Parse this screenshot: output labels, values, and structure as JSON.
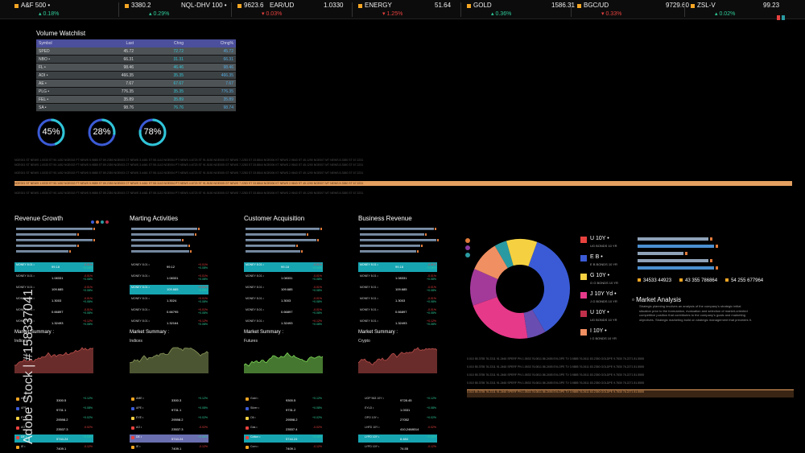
{
  "ticker": [
    {
      "name": "A&F 500 •",
      "value": "",
      "change": "0.18% ",
      "dir": "up"
    },
    {
      "name": "3380.2",
      "value": "NQL-DHV 100 •",
      "change": "0.29% ",
      "dir": "up"
    },
    {
      "name": "9623.6",
      "value": "EAR/UD",
      "change": "0.03% ",
      "dir": "dn"
    },
    {
      "name": "",
      "value": "1.0330",
      "change": "",
      "dir": "dn"
    },
    {
      "name": "ENERGY",
      "value": "51.64",
      "change": "1.25% ",
      "dir": "dn"
    },
    {
      "name": "GOLD",
      "value": "1586.31",
      "change": "0.36% ",
      "dir": "up"
    },
    {
      "name": "BGC/UD",
      "value": "9729.60",
      "change": "0.33% ",
      "dir": "dn"
    },
    {
      "name": "ZSL-V",
      "value": "99.23",
      "change": "0.02% ",
      "dir": "up"
    }
  ],
  "watchlist": {
    "title": "Volume Watchlist",
    "columns": [
      "Symbol",
      "Last",
      "Chng",
      "Chng%"
    ],
    "rows": [
      [
        "SPED",
        "45.72",
        "72.72",
        "45.72"
      ],
      [
        "NBO •",
        "66.31",
        "31.31",
        "66.31"
      ],
      [
        "FL •",
        "98.46",
        "46.46",
        "98.46"
      ],
      [
        "ADI •",
        "466.35",
        "35.35",
        "466.35"
      ],
      [
        "AE •",
        "7.67",
        "67.67",
        "7.67"
      ],
      [
        "PLG •",
        "776.35",
        "35.35",
        "776.35"
      ],
      [
        "FEL •",
        "35.89",
        "35.89",
        "35.89"
      ],
      [
        "SA •",
        "98.76",
        "76.76",
        "98.74"
      ]
    ]
  },
  "gauges": [
    {
      "label": "45%",
      "value": 0.45
    },
    {
      "label": "28%",
      "value": 0.28
    },
    {
      "label": "78%",
      "value": 0.78
    }
  ],
  "colors": {
    "teal": "#17a5b2",
    "orange": "#e5a060",
    "blue": "#3b5bd6",
    "ticker_accent": "#f5a623"
  },
  "panels": [
    {
      "title": "Revenue Growth",
      "summary": "Market Summary :",
      "sub": "Indices",
      "chart_color": "#c0504d",
      "rows": [
        {
          "a": "MONEY 8.01 •",
          "b": "99.18",
          "c1": "-0.01%",
          "c2": "+0.08%",
          "hl": true
        },
        {
          "a": "MONEY 8.01 •",
          "b": "1.08331",
          "c1": "-0.01%",
          "c2": "+0.08%",
          "hl": false
        },
        {
          "a": "MONEY 8.01 •",
          "b": "109.685",
          "c1": "-0.01%",
          "c2": "+0.08%",
          "hl": false
        },
        {
          "a": "MONEY 8.01 •",
          "b": "1.3003",
          "c1": "-0.01%",
          "c2": "+0.08%",
          "hl": false
        },
        {
          "a": "MONEY 8.01 •",
          "b": "0.66897",
          "c1": "-0.01%",
          "c2": "+0.08%",
          "hl": false
        },
        {
          "a": "MONEY 8.01 •",
          "b": "1.32493",
          "c1": "+0.12%",
          "c2": "+0.08%",
          "hl": false
        }
      ],
      "details": [
        {
          "a": "AME •",
          "b": "3300.5",
          "c": "+0.12%",
          "hl": "",
          "dot": "#f5a623"
        },
        {
          "a": "APE •",
          "b": "9731.1",
          "c": "+0.08%",
          "hl": "",
          "dot": "#3b5bd6"
        },
        {
          "a": "EYE •",
          "b": "29598.2",
          "c": "+0.02%",
          "hl": "",
          "dot": "#f5d142"
        },
        {
          "a": "AO •",
          "b": "23537.3",
          "c": "-0.02%",
          "hl": "",
          "dot": "#e8423f"
        },
        {
          "a": "DE •",
          "b": "5744.24",
          "c": "+0.08%",
          "hl": "hl",
          "dot": "#e8423f"
        },
        {
          "a": "IE •",
          "b": "7409.1",
          "c": "-0.12%",
          "hl": "",
          "dot": "#f5a623"
        }
      ]
    },
    {
      "title": "Marting Activities",
      "summary": "Market Summary :",
      "sub": "Indices",
      "chart_color": "#8a9a5b",
      "rows": [
        {
          "a": "MONEY 8.01 •",
          "b": "99.12",
          "c1": "+0.01%",
          "c2": "+0.08%",
          "hl": false
        },
        {
          "a": "MONEY 8.01 •",
          "b": "1.08331",
          "c1": "+0.01%",
          "c2": "+0.08%",
          "hl": false
        },
        {
          "a": "MONEY 8.01 •",
          "b": "109.685",
          "c1": "+0.01%",
          "c2": "+0.08%",
          "hl": true
        },
        {
          "a": "MONEY 8.01 •",
          "b": "1.3024",
          "c1": "+0.01%",
          "c2": "+0.08%",
          "hl": false
        },
        {
          "a": "MONEY 8.01 •",
          "b": "0.66795",
          "c1": "+0.01%",
          "c2": "+0.08%",
          "hl": false
        },
        {
          "a": "MONEY 8.01 •",
          "b": "1.32164",
          "c1": "+0.12%",
          "c2": "+0.08%",
          "hl": false
        }
      ],
      "details": [
        {
          "a": "AME •",
          "b": "3300.3",
          "c": "+0.12%",
          "hl": "",
          "dot": "#f5a623"
        },
        {
          "a": "APE •",
          "b": "9731.1",
          "c": "+0.08%",
          "hl": "",
          "dot": "#3b5bd6"
        },
        {
          "a": "EYE •",
          "b": "29598.2",
          "c": "+0.02%",
          "hl": "",
          "dot": "#f5d142"
        },
        {
          "a": "AO •",
          "b": "23537.3",
          "c": "-0.02%",
          "hl": "",
          "dot": "#e8423f"
        },
        {
          "a": "DE •",
          "b": "5744.24",
          "c": "+0.08%",
          "hl": "hl2",
          "dot": "#e8423f"
        },
        {
          "a": "IE •",
          "b": "7409.1",
          "c": "-0.12%",
          "hl": "",
          "dot": "#f5a623"
        }
      ]
    },
    {
      "title": "Customer Acquisition",
      "summary": "Market Summary :",
      "sub": "Futures",
      "chart_color": "#7ed957",
      "rows": [
        {
          "a": "MONEY 8.01 •",
          "b": "99.18",
          "c1": "-0.01%",
          "c2": "+0.08%",
          "hl": true
        },
        {
          "a": "MONEY 8.01 •",
          "b": "1.08331",
          "c1": "-0.01%",
          "c2": "+0.08%",
          "hl": false
        },
        {
          "a": "MONEY 8.01 •",
          "b": "109.685",
          "c1": "-0.01%",
          "c2": "+0.08%",
          "hl": false
        },
        {
          "a": "MONEY 8.01 •",
          "b": "1.3003",
          "c1": "-0.01%",
          "c2": "+0.08%",
          "hl": false
        },
        {
          "a": "MONEY 8.01 •",
          "b": "0.66897",
          "c1": "-0.01%",
          "c2": "+0.08%",
          "hl": false
        },
        {
          "a": "MONEY 8.01 •",
          "b": "1.32493",
          "c1": "+0.12%",
          "c2": "+0.08%",
          "hl": false
        }
      ],
      "details": [
        {
          "a": "Gold •",
          "b": "9300.5",
          "c": "+0.12%",
          "hl": "",
          "dot": "#f5a623"
        },
        {
          "a": "Silver •",
          "b": "9731.2",
          "c": "+0.08%",
          "hl": "",
          "dot": "#3b5bd6"
        },
        {
          "a": "Oil •",
          "b": "29598.2",
          "c": "+0.02%",
          "hl": "",
          "dot": "#f5d142"
        },
        {
          "a": "Gas •",
          "b": "23537.4",
          "c": "-0.02%",
          "hl": "",
          "dot": "#e8423f"
        },
        {
          "a": "Cotton •",
          "b": "5744.24",
          "c": "+0.08%",
          "hl": "hl",
          "dot": "#e8423f"
        },
        {
          "a": "Corn •",
          "b": "7409.1",
          "c": "-0.12%",
          "hl": "",
          "dot": "#f5a623"
        }
      ]
    },
    {
      "title": "Business Revenue",
      "summary": "Market Summary :",
      "sub": "Crypto",
      "chart_color": "#c0504d",
      "rows": [
        {
          "a": "MONEY 8.01 •",
          "b": "99.18",
          "c1": "-0.01%",
          "c2": "+0.08%",
          "hl": true
        },
        {
          "a": "MONEY 8.01 •",
          "b": "1.08331",
          "c1": "-0.01%",
          "c2": "+0.08%",
          "hl": false
        },
        {
          "a": "MONEY 8.01 •",
          "b": "109.685",
          "c1": "-0.01%",
          "c2": "+0.08%",
          "hl": false
        },
        {
          "a": "MONEY 8.01 •",
          "b": "1.3003",
          "c1": "-0.01%",
          "c2": "+0.08%",
          "hl": false
        },
        {
          "a": "MONEY 8.01 •",
          "b": "0.66897",
          "c1": "-0.01%",
          "c2": "+0.08%",
          "hl": false
        },
        {
          "a": "MONEY 8.01 •",
          "b": "1.32493",
          "c1": "+0.12%",
          "c2": "+0.08%",
          "hl": false
        }
      ],
      "details": [
        {
          "a": "UOP 563 10Y •",
          "b": "9728.45",
          "c": "+0.12%",
          "hl": "",
          "dot": ""
        },
        {
          "a": "EYLD •",
          "b": "1.0331",
          "c": "+0.08%",
          "hl": "",
          "dot": ""
        },
        {
          "a": "OPO 10Y •",
          "b": "27052",
          "c": "+0.02%",
          "hl": "",
          "dot": ""
        },
        {
          "a": "LHFD 10Y •",
          "b": "410,2468014",
          "c": "-0.02%",
          "hl": "",
          "dot": ""
        },
        {
          "a": "LYPD 10Y •",
          "b": "6.484",
          "c": "+0.08%",
          "hl": "hl",
          "dot": ""
        },
        {
          "a": "LYPD 10Y •",
          "b": "74.55",
          "c": "-0.12%",
          "hl": "",
          "dot": ""
        }
      ]
    }
  ],
  "donut": {
    "slices": [
      {
        "name": "blue",
        "value": 0.36,
        "color": "#3b5bd6"
      },
      {
        "name": "purple",
        "value": 0.06,
        "color": "#6a4db0"
      },
      {
        "name": "pink",
        "value": 0.22,
        "color": "#e6398a"
      },
      {
        "name": "magenta",
        "value": 0.12,
        "color": "#a33a9a"
      },
      {
        "name": "salmon",
        "value": 0.1,
        "color": "#f08f62"
      },
      {
        "name": "teal",
        "value": 0.04,
        "color": "#2a9aa2"
      },
      {
        "name": "yellow",
        "value": 0.1,
        "color": "#f5d142"
      }
    ]
  },
  "legend": [
    {
      "name": "U 10Y •",
      "sub": "UG BONDS 10 YR",
      "color": "#e8423f"
    },
    {
      "name": "E B •",
      "sub": "E B BONDS 10 YR",
      "color": "#3b5bd6"
    },
    {
      "name": "G 10Y •",
      "sub": "G G BONDS 10 YR",
      "color": "#f5d142"
    },
    {
      "name": "J 10Y Yd •",
      "sub": "J G BONDS 10 YR",
      "color": "#e6398a"
    },
    {
      "name": "U 10Y •",
      "sub": "UG BONDS 10 YR",
      "color": "#c0304a"
    },
    {
      "name": "I 10Y •",
      "sub": "I G BONDS 10 YR",
      "color": "#f08f62"
    }
  ],
  "right_bars": [
    {
      "level": 0.93,
      "color": "#8ea2b8"
    },
    {
      "level": 1.0,
      "color": "#4a8fd0"
    },
    {
      "level": 0.6,
      "color": "#8ea2b8"
    },
    {
      "level": 0.93,
      "color": "#8ea2b8"
    },
    {
      "level": 1.0,
      "color": "#4a8fd0"
    }
  ],
  "right_stats": [
    "34533 44923",
    "43 355 786864",
    "54 255 677964"
  ],
  "market_analysis": {
    "title": "Market Analysis",
    "body": "Strategic planning involves an analysis of the company's strategic initial situation prior to the formulation, evaluation and selection of market-oriented competitive position that contributes to the company's goals and marketing objectives. Strategic marketing build on strategic management that precedes it."
  },
  "bottom_table_text": "0.010 55.3755  76.2311  91.2460   SPERF PN  1.0533  76.0811  86.2455   EVLOPE TV  3.9885  76.2611  83.2350   GOLDPE 9.7830  76.2271  81.5555",
  "band_text": "NGE001 ST NEWS 1.0033 ST  90.1452    NGE002 FT NEWS 5.9885 ST  89.2350   NGE003 CT NEWS 3.4461 ST  55.1142   NGE004 PT NEWS 4.6723 ST  91.5150   NGE005 GT NEWS 7.2283 ST  33.8844   NGE006 KT NEWS 2.9843 ST  45.1290   NGE007 MT NEWS 8.3380 ST  67.2231",
  "watermark": "Adobe Stock | #158337041"
}
